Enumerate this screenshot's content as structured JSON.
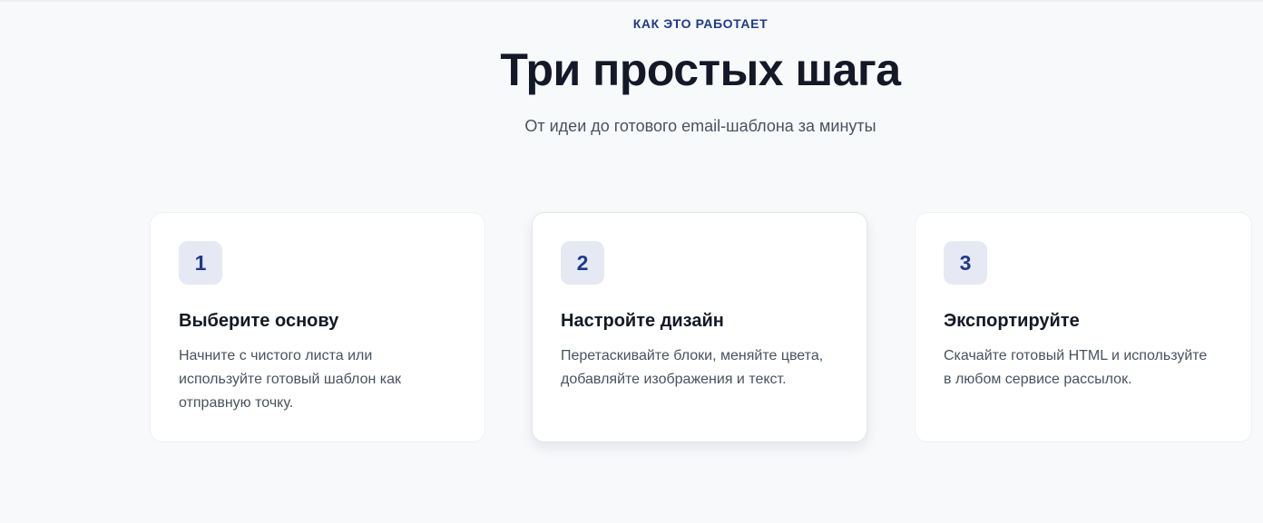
{
  "section": {
    "eyebrow": "КАК ЭТО РАБОТАЕТ",
    "title": "Три простых шага",
    "subtitle": "От идеи до готового email-шаблона за минуты"
  },
  "steps": [
    {
      "number": "1",
      "title": "Выберите основу",
      "text": "Начните с чистого листа или используйте готовый шаблон как отправную точку."
    },
    {
      "number": "2",
      "title": "Настройте дизайн",
      "text": "Перетаскивайте блоки, меняйте цвета, добавляйте изображения и текст."
    },
    {
      "number": "3",
      "title": "Экспортируйте",
      "text": "Скачайте готовый HTML и используйте в любом сервисе рассылок."
    }
  ],
  "colors": {
    "accent": "#1e3a8a",
    "badge_bg": "#e6e9f4",
    "heading": "#141827",
    "body_text": "#4a5160",
    "page_bg": "#f8f9fb"
  }
}
